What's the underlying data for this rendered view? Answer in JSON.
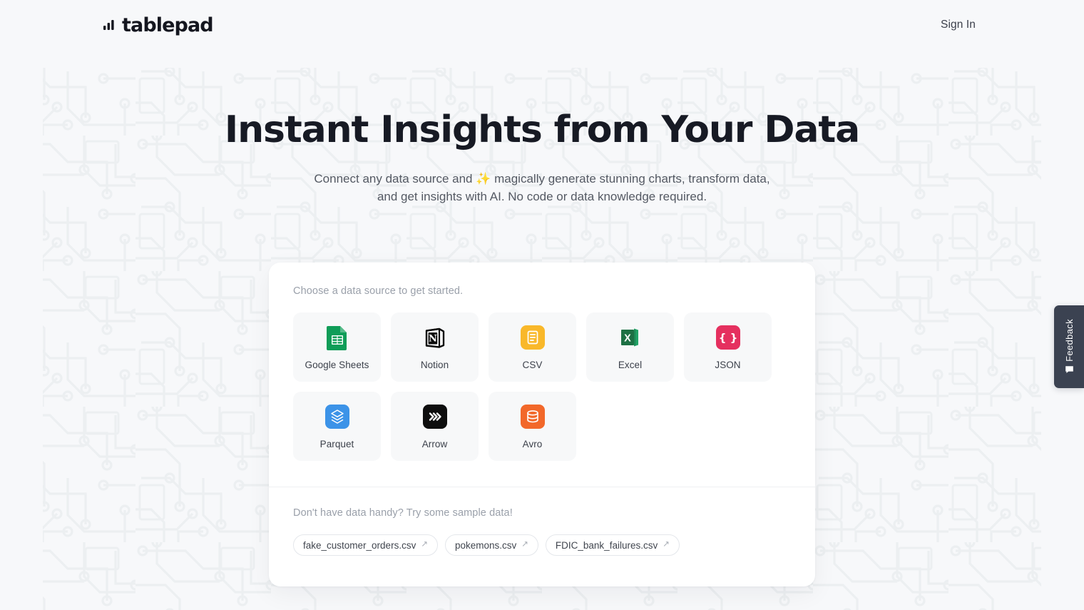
{
  "header": {
    "logo_text": "tablepad",
    "logo_icon": "bar-chart-icon",
    "sign_in_label": "Sign In"
  },
  "hero": {
    "title": "Instant Insights from Your Data",
    "subtitle": "Connect any data source and ✨ magically generate stunning charts, transform data, and get insights with AI. No code or data knowledge required."
  },
  "card": {
    "prompt": "Choose a data source to get started.",
    "sources": [
      {
        "label": "Google Sheets",
        "icon": "google-sheets-icon",
        "color": "#0F9D58"
      },
      {
        "label": "Notion",
        "icon": "notion-icon",
        "color": "#000000"
      },
      {
        "label": "CSV",
        "icon": "csv-icon",
        "color": "#F9B82A"
      },
      {
        "label": "Excel",
        "icon": "excel-icon",
        "color": "#1D7044"
      },
      {
        "label": "JSON",
        "icon": "json-icon",
        "color": "#E5305F"
      },
      {
        "label": "Parquet",
        "icon": "parquet-icon",
        "color": "#3C93E8"
      },
      {
        "label": "Arrow",
        "icon": "arrow-icon",
        "color": "#0E0E0E"
      },
      {
        "label": "Avro",
        "icon": "avro-icon",
        "color": "#F2682A"
      }
    ],
    "sample_prompt": "Don't have data handy? Try some sample data!",
    "samples": [
      {
        "label": "fake_customer_orders.csv",
        "ext_icon": "↗"
      },
      {
        "label": "pokemons.csv",
        "ext_icon": "↗"
      },
      {
        "label": "FDIC_bank_failures.csv",
        "ext_icon": "↗"
      }
    ]
  },
  "feedback": {
    "label": "Feedback",
    "icon": "speech-bubble-icon"
  },
  "theme": {
    "page_bg": "#f7f8fa",
    "pattern": "#ebeef1",
    "card_bg": "#ffffff",
    "tile_bg": "#f7f8f9",
    "text_dark": "#171a24",
    "text_muted": "#9aa0aa",
    "feedback_bg": "#3b4251"
  }
}
